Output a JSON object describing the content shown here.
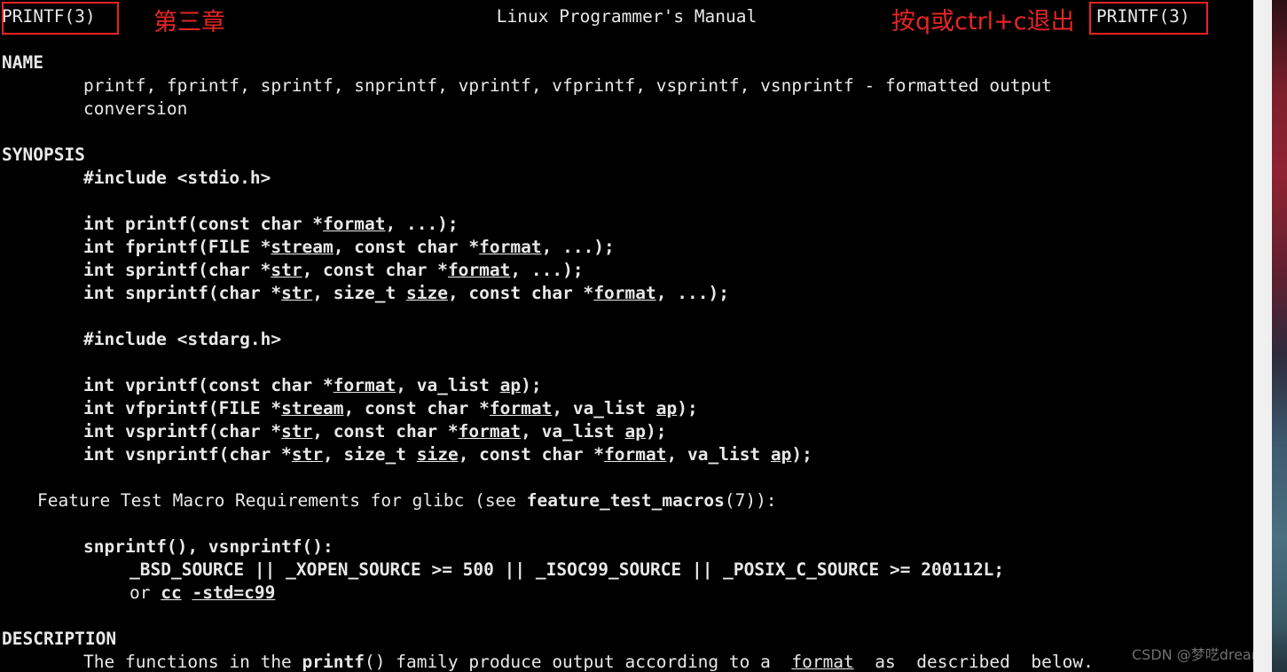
{
  "window": {
    "background": "#000000",
    "foreground": "#e8e8e8",
    "annotation_color": "#e72525",
    "scrollbar_color": "#f0f0f0"
  },
  "header": {
    "left_tag": "PRINTF(3)",
    "title": "Linux Programmer's Manual",
    "right_tag": "PRINTF(3)"
  },
  "annotations": {
    "chapter": "第三章",
    "quit_hint": "按q或ctrl+c退出"
  },
  "watermark": "CSDN @梦呓dream",
  "sections": {
    "name": {
      "heading": "NAME",
      "line1": "printf, fprintf, sprintf, snprintf, vprintf, vfprintf, vsprintf, vsnprintf - formatted output",
      "line2": "conversion"
    },
    "synopsis": {
      "heading": "SYNOPSIS",
      "include_stdio": "#include <stdio.h>",
      "include_stdarg": "#include <stdarg.h>",
      "protos_stdio": [
        {
          "pre": "int printf(const char *",
          "u1": "format",
          "mid": ", ...);",
          "u2": "",
          "post": ""
        },
        {
          "pre": "int fprintf(FILE *",
          "u1": "stream",
          "mid": ", const char *",
          "u2": "format",
          "post": ", ...);"
        },
        {
          "pre": "int sprintf(char *",
          "u1": "str",
          "mid": ", const char *",
          "u2": "format",
          "post": ", ...);"
        },
        {
          "pre": "int snprintf(char *",
          "u1": "str",
          "mid": ", size_t ",
          "u2": "size",
          "post": ", const char *",
          "u3": "format",
          "tail": ", ...);"
        }
      ],
      "protos_stdarg": [
        {
          "pre": "int vprintf(const char *",
          "u1": "format",
          "mid": ", va_list ",
          "u2": "ap",
          "post": ");"
        },
        {
          "pre": "int vfprintf(FILE *",
          "u1": "stream",
          "mid": ", const char *",
          "u2": "format",
          "post": ", va_list ",
          "u3": "ap",
          "tail": ");"
        },
        {
          "pre": "int vsprintf(char *",
          "u1": "str",
          "mid": ", const char *",
          "u2": "format",
          "post": ", va_list ",
          "u3": "ap",
          "tail": ");"
        },
        {
          "pre": "int vsnprintf(char *",
          "u1": "str",
          "mid": ", size_t ",
          "u2": "size",
          "post": ", const char *",
          "u3": "format",
          "tail": ", va_list ",
          "u4": "ap",
          "tail2": ");"
        }
      ],
      "feature_test": {
        "pre": "Feature Test Macro Requirements for glibc (see ",
        "bold": "feature_test_macros",
        "post": "(7)):"
      },
      "requirements": {
        "funcs": "snprintf(), vsnprintf():",
        "macros": "_BSD_SOURCE || _XOPEN_SOURCE >= 500 || _ISOC99_SOURCE || _POSIX_C_SOURCE >= 200112L;",
        "or_pre": "or ",
        "or_cc": "cc",
        "or_mid": " ",
        "or_std": "-std=c99"
      }
    },
    "description": {
      "heading": "DESCRIPTION",
      "line1_pre": "The functions in the ",
      "line1_bold": "printf",
      "line1_mid": "() family produce output according to a  ",
      "line1_ul": "format",
      "line1_post": "  as  described  below."
    }
  }
}
